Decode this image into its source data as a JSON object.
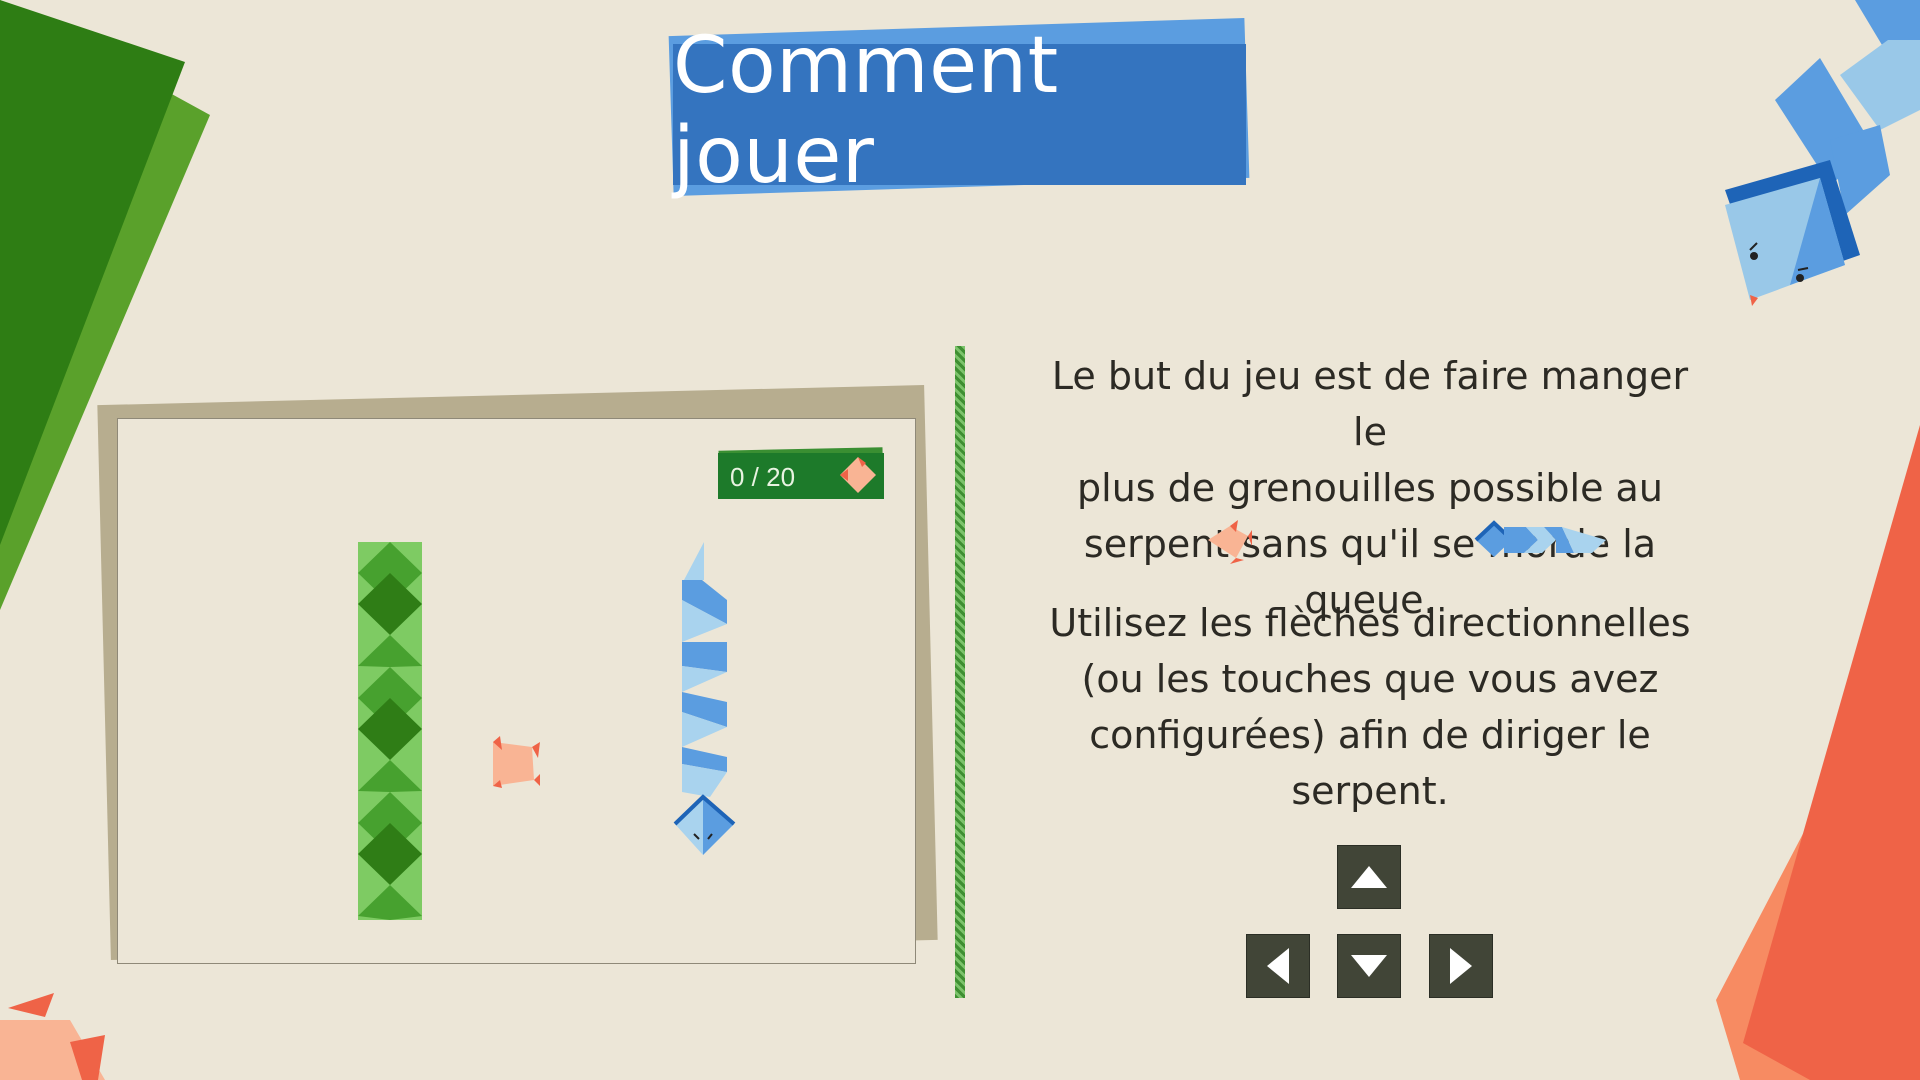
{
  "title": "Comment jouer",
  "score": {
    "value": "0 / 20",
    "icon": "frog-icon"
  },
  "instructions": {
    "paragraph1": "Le but du jeu est de faire manger le plus de grenouilles possible au serpent sans qu'il se morde la queue.",
    "p1_lines": [
      "Le but du jeu est de faire manger le",
      "plus de grenouilles possible au",
      "serpent sans qu'il se morde la"
    ],
    "p1_last": "queue.",
    "paragraph2_lines": [
      "Utilisez les flèches directionnelles",
      "(ou les touches que vous avez",
      "configurées) afin de diriger le",
      "serpent."
    ]
  },
  "keys": [
    {
      "name": "up",
      "icon": "arrow-up-icon"
    },
    {
      "name": "left",
      "icon": "arrow-left-icon"
    },
    {
      "name": "down",
      "icon": "arrow-down-icon"
    },
    {
      "name": "right",
      "icon": "arrow-right-icon"
    }
  ],
  "colors": {
    "background": "#ece6d7",
    "title_banner": "#3474bf",
    "score_chip": "#1d7a2a",
    "key": "#414537",
    "snake_blue": "#5b9de0",
    "frog": "#f9b494",
    "green_strip": "#2e7d14",
    "orange_paper": "#ef6347"
  }
}
